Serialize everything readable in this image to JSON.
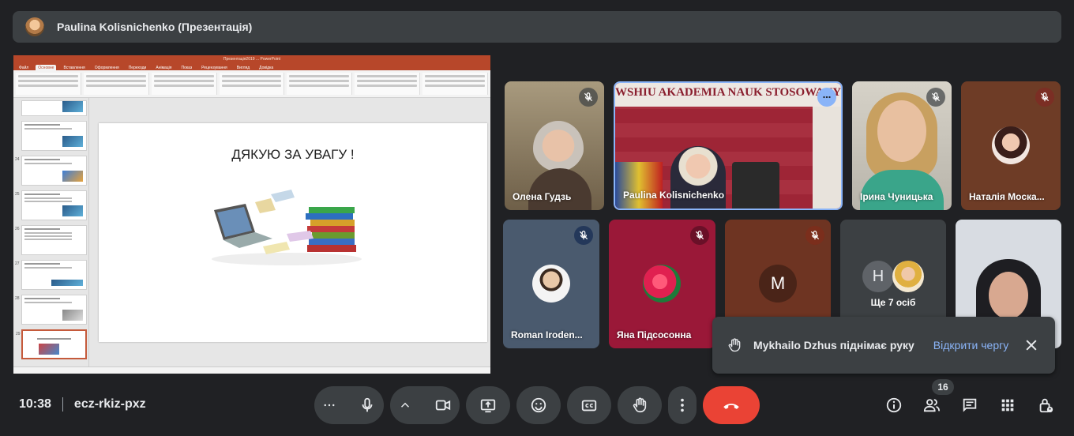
{
  "top_bar": {
    "presenter_title": "Paulina Kolisnichenko (Презентація)"
  },
  "presentation": {
    "window_title": "Презентація2019 ...  PowerPoint",
    "tabs": [
      "Файл",
      "Основне",
      "Вставлення",
      "Оформлення",
      "Переходи",
      "Анімація",
      "Показ",
      "Рецензування",
      "Вигляд",
      "Довідка"
    ],
    "slide_title": "ДЯКУЮ ЗА УВАГУ !",
    "thumb_numbers": [
      "",
      "",
      "24",
      "25",
      "26",
      "27",
      "28",
      "29"
    ]
  },
  "participants": [
    {
      "name": "Олена Гудзь",
      "muted": true
    },
    {
      "name": "Paulina Kolisnichenko",
      "banner": "WSHIU AKADEMIA NAUK STOSOWANYCH",
      "muted": false
    },
    {
      "name": "Ірина Чуницька",
      "muted": true
    },
    {
      "name": "Наталія Моска...",
      "muted": true
    },
    {
      "name": "Roman Iroden...",
      "muted": true
    },
    {
      "name": "Яна Підсосонна",
      "muted": true
    },
    {
      "name": "",
      "initial": "M",
      "muted": true
    },
    {
      "name": "Ще 7 осіб",
      "initial": "H"
    },
    {
      "name": ""
    }
  ],
  "notification": {
    "text": "Mykhailo Dzhus піднімає руку",
    "action": "Відкрити чергу"
  },
  "meeting": {
    "time": "10:38",
    "code": "ecz-rkiz-pxz",
    "participant_count": "16"
  },
  "colors": {
    "background": "#202124",
    "panel": "#3c4043",
    "end_call": "#ea4335",
    "link": "#8ab4f8"
  }
}
